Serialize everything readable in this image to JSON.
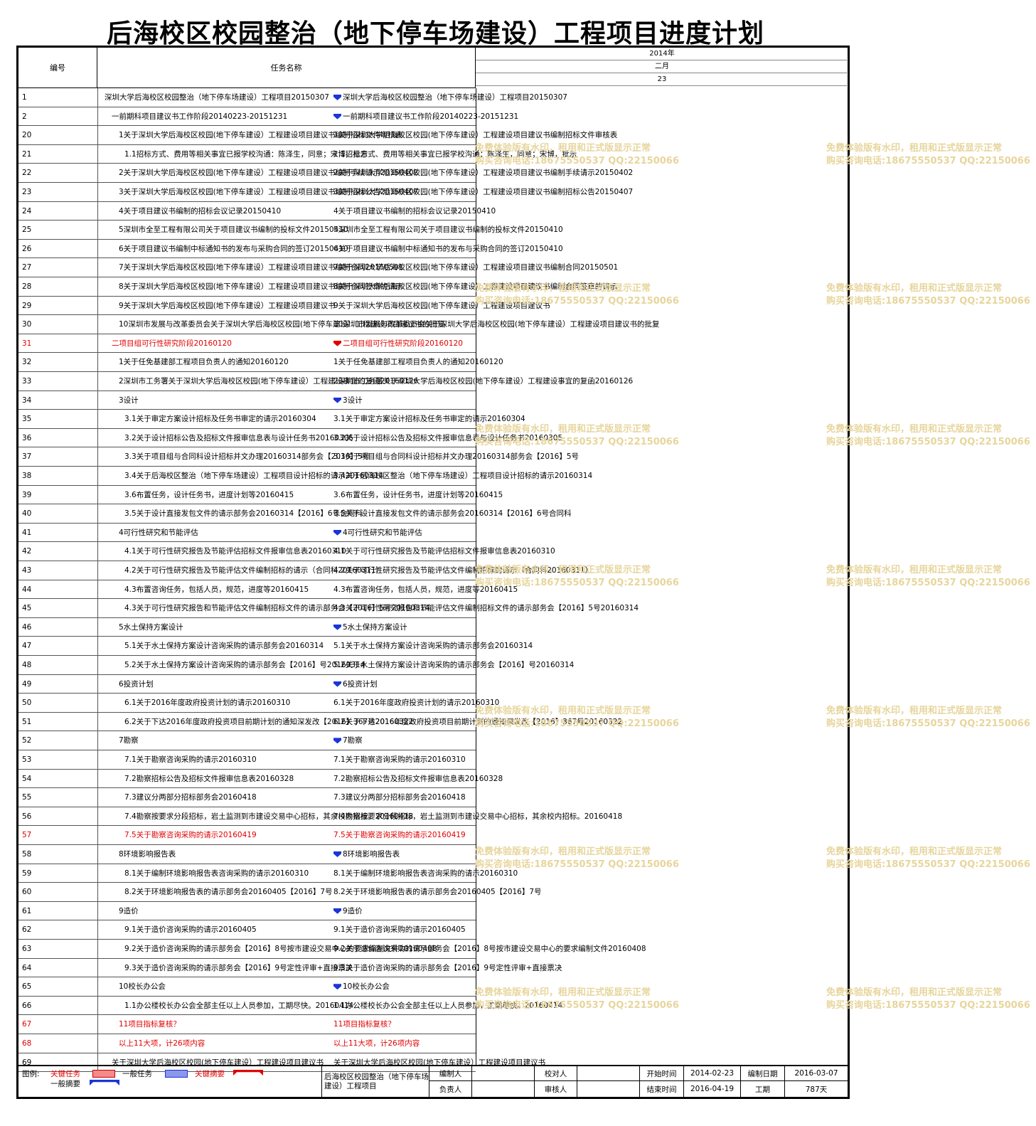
{
  "title": "后海校区校园整治（地下停车场建设）工程项目进度计划",
  "header": {
    "no": "编号",
    "name": "任务名称",
    "year": "2014年",
    "month": "二月",
    "day": "23"
  },
  "watermark": {
    "line1": "免费体验版有水印，租用和正式版显示正常",
    "line2": "购买咨询电话:18675550537 QQ:22150066"
  },
  "rows": [
    {
      "no": "1",
      "name": "深圳大学后海校区校园整治（地下停车场建设）工程项目20150307",
      "indent": 0,
      "marker": "blue"
    },
    {
      "no": "2",
      "name": "一前期科项目建议书工作阶段20140223-20151231",
      "indent": 1,
      "marker": "blue"
    },
    {
      "no": "20",
      "name": "1关于深圳大学后海校区校园(地下停车建设）工程建设项目建议书编制招标文件审核表",
      "indent": 2,
      "marker": ""
    },
    {
      "no": "21",
      "name": "1.1招标方式、费用等相关事宜已报学校沟通：陈泽生，同意；宋博，批示",
      "indent": 3,
      "marker": ""
    },
    {
      "no": "22",
      "name": "2关于深圳大学后海校区校园(地下停车建设）工程建设项目建议书编制手续请示20150402",
      "indent": 2,
      "marker": ""
    },
    {
      "no": "23",
      "name": "3关于深圳大学后海校区校园(地下停车建设）工程建设项目建议书编制招标公告20150407",
      "indent": 2,
      "marker": ""
    },
    {
      "no": "24",
      "name": "4关于项目建议书编制的招标会议记录20150410",
      "indent": 2,
      "marker": ""
    },
    {
      "no": "25",
      "name": "5深圳市全至工程有限公司关于项目建议书编制的投标文件20150410",
      "indent": 2,
      "marker": ""
    },
    {
      "no": "26",
      "name": "6关于项目建议书编制中标通知书的发布与采购合同的签订20150410",
      "indent": 2,
      "marker": ""
    },
    {
      "no": "27",
      "name": "7关于深圳大学后海校区校园(地下停车建设）工程建设项目建议书编制合同20150501",
      "indent": 2,
      "marker": ""
    },
    {
      "no": "28",
      "name": "8关于深圳大学后海校区校园(地下停车建设）工程建设项目建议书编制合同签章的请示",
      "indent": 2,
      "marker": ""
    },
    {
      "no": "29",
      "name": "9关于深圳大学后海校区校园(地下停车建设）工程建设项目建议书",
      "indent": 2,
      "marker": ""
    },
    {
      "no": "30",
      "name": "10深圳市发展与改革委员会关于深圳大学后海校区校园(地下停车建设）工程建设项目建议书的批复",
      "indent": 2,
      "marker": ""
    },
    {
      "no": "31",
      "name": "二项目组可行性研究阶段20160120",
      "indent": 1,
      "marker": "red",
      "red": true
    },
    {
      "no": "32",
      "name": "1关于任免基建部工程项目负责人的通知20160120",
      "indent": 2,
      "marker": ""
    },
    {
      "no": "33",
      "name": "2深圳市工务署关于深圳大学后海校区校园(地下停车建设）工程建设事宜的复函20160126",
      "indent": 2,
      "marker": ""
    },
    {
      "no": "34",
      "name": "3设计",
      "indent": 2,
      "marker": "blue"
    },
    {
      "no": "35",
      "name": "3.1关于审定方案设计招标及任务书审定的请示20160304",
      "indent": 3,
      "marker": ""
    },
    {
      "no": "36",
      "name": "3.2关于设计招标公告及招标文件报审信息表与设计任务书20160305",
      "indent": 3,
      "marker": ""
    },
    {
      "no": "37",
      "name": "3.3关于项目组与合同科设计招标并文办理20160314部务会【2016】5号",
      "indent": 3,
      "marker": ""
    },
    {
      "no": "38",
      "name": "3.4关于后海校区整治（地下停车场建设）工程项目设计招标的请示20160314",
      "indent": 3,
      "marker": ""
    },
    {
      "no": "39",
      "name": "3.6布置任务，设计任务书，进度计划等20160415",
      "indent": 3,
      "marker": ""
    },
    {
      "no": "40",
      "name": "3.5关于设计直接发包文件的请示部务会20160314【2016】6号合同科",
      "indent": 3,
      "marker": ""
    },
    {
      "no": "41",
      "name": "4可行性研究和节能评估",
      "indent": 2,
      "marker": "blue"
    },
    {
      "no": "42",
      "name": "4.1关于可行性研究报告及节能评估招标文件报审信息表20160310",
      "indent": 3,
      "marker": ""
    },
    {
      "no": "43",
      "name": "4.2关于可行性研究报告及节能评估文件编制招标的请示（合同科20160311）",
      "indent": 3,
      "marker": ""
    },
    {
      "no": "44",
      "name": "4.3布置咨询任务，包括人员，规范，进度等20160415",
      "indent": 3,
      "marker": ""
    },
    {
      "no": "45",
      "name": "4.3关于可行性研究报告和节能评估文件编制招标文件的请示部务会【2016】5号20160314",
      "indent": 3,
      "marker": ""
    },
    {
      "no": "46",
      "name": "5水土保持方案设计",
      "indent": 2,
      "marker": "blue"
    },
    {
      "no": "47",
      "name": "5.1关于水土保持方案设计咨询采购的请示部务会20160314",
      "indent": 3,
      "marker": ""
    },
    {
      "no": "48",
      "name": "5.2关于水土保持方案设计咨询采购的请示部务会【2016】号20160314",
      "indent": 3,
      "marker": ""
    },
    {
      "no": "49",
      "name": "6投资计划",
      "indent": 2,
      "marker": "blue"
    },
    {
      "no": "50",
      "name": "6.1关于2016年度政府投资计划的请示20160310",
      "indent": 3,
      "marker": ""
    },
    {
      "no": "51",
      "name": "6.2关于下达2016年度政府投资项目前期计划的通知深发改【2016】367号20160322",
      "indent": 3,
      "marker": ""
    },
    {
      "no": "52",
      "name": "7勘察",
      "indent": 2,
      "marker": "blue"
    },
    {
      "no": "53",
      "name": "7.1关于勘察咨询采购的请示20160310",
      "indent": 3,
      "marker": ""
    },
    {
      "no": "54",
      "name": "7.2勘察招标公告及招标文件报审信息表20160328",
      "indent": 3,
      "marker": ""
    },
    {
      "no": "55",
      "name": "7.3建议分两部分招标部务会20160418",
      "indent": 3,
      "marker": ""
    },
    {
      "no": "56",
      "name": "7.4勘察按要求分段招标，岩土监测到市建设交易中心招标，其余校内招标。20160418",
      "indent": 3,
      "marker": ""
    },
    {
      "no": "57",
      "name": "7.5关于勘察咨询采购的请示20160419",
      "indent": 3,
      "marker": "",
      "red": true
    },
    {
      "no": "58",
      "name": "8环境影响报告表",
      "indent": 2,
      "marker": "blue"
    },
    {
      "no": "59",
      "name": "8.1关于编制环境影响报告表咨询采购的请示20160310",
      "indent": 3,
      "marker": ""
    },
    {
      "no": "60",
      "name": "8.2关于环境影响报告表的请示部务会20160405【2016】7号",
      "indent": 3,
      "marker": ""
    },
    {
      "no": "61",
      "name": "9造价",
      "indent": 2,
      "marker": "blue"
    },
    {
      "no": "62",
      "name": "9.1关于造价咨询采购的请示20160405",
      "indent": 3,
      "marker": ""
    },
    {
      "no": "63",
      "name": "9.2关于造价咨询采购的请示部务会【2016】8号按市建设交易中心的要求编制文件20160408",
      "indent": 3,
      "marker": ""
    },
    {
      "no": "64",
      "name": "9.3关于造价咨询采购的请示部务会【2016】9号定性评审+直接票决",
      "indent": 3,
      "marker": ""
    },
    {
      "no": "65",
      "name": "10校长办公会",
      "indent": 2,
      "marker": "blue"
    },
    {
      "no": "66",
      "name": "1.1办公楼校长办公会全部主任以上人员参加，工期尽快。20160414",
      "indent": 3,
      "marker": ""
    },
    {
      "no": "67",
      "name": "11项目指标复核？",
      "indent": 2,
      "marker": "",
      "red": true
    },
    {
      "no": "68",
      "name": "以上11大项，计26项内容",
      "indent": 2,
      "marker": "",
      "red": true
    },
    {
      "no": "69",
      "name": "关于深圳大学后海校区校园(地下停车建设）工程建设项目建议书",
      "indent": 1,
      "marker": ""
    }
  ],
  "legend": {
    "label": "图例:",
    "critical": "关键任务",
    "normal": "一般任务",
    "critical_summary": "关键摘要",
    "normal_summary": "一般摘要"
  },
  "footer": {
    "project": "后海校区校园整治（地下停车场建设）工程项目",
    "editor_label": "编制人",
    "owner_label": "负责人",
    "checker_label": "校对人",
    "reviewer_label": "审核人",
    "start_label": "开始时间",
    "start": "2014-02-23",
    "end_label": "结束时间",
    "end": "2016-04-19",
    "date_label": "编制日期",
    "date": "2016-03-07",
    "duration_label": "工期",
    "duration": "787天"
  },
  "colors": {
    "blue_marker": "#1a35d8",
    "red_marker": "#e00000",
    "watermark": "#e7d59c"
  }
}
